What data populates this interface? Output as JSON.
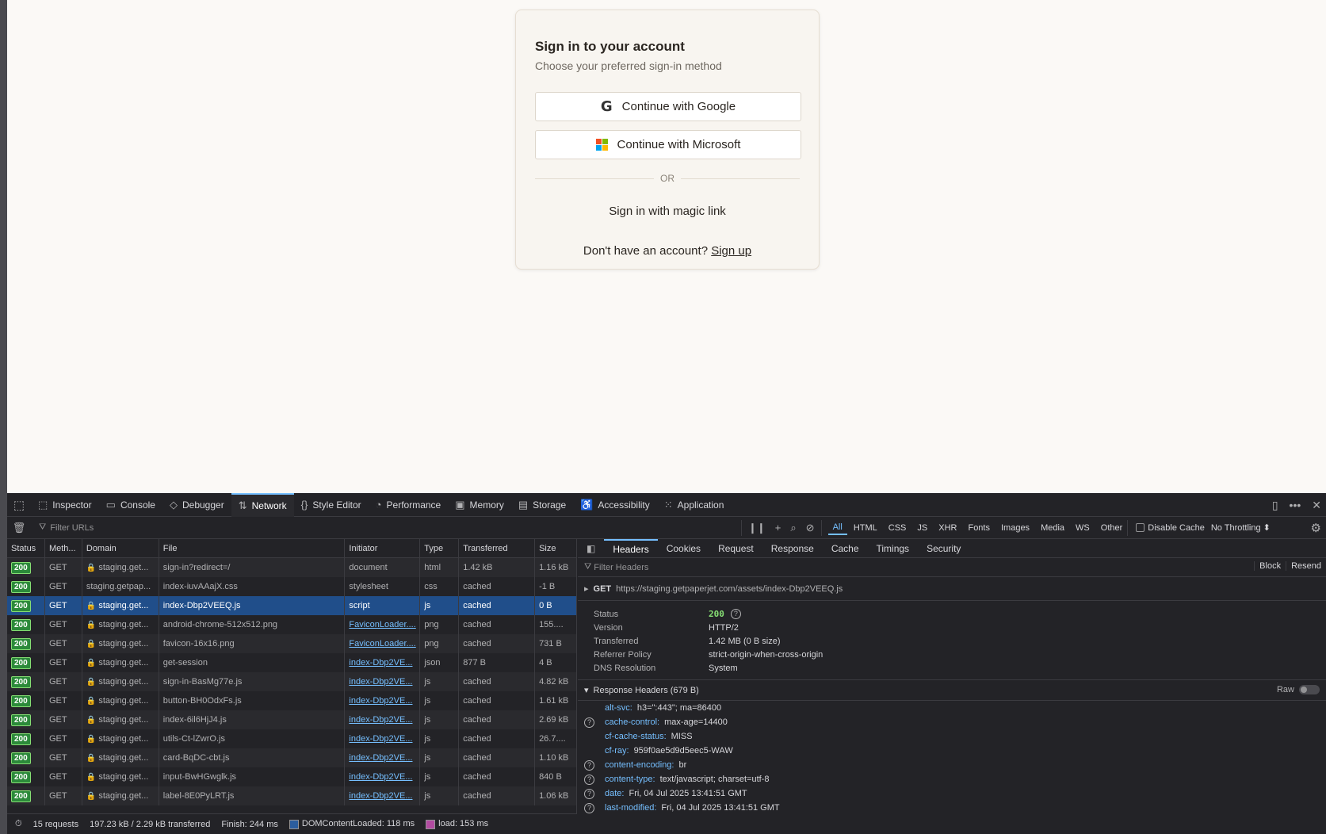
{
  "signin": {
    "title": "Sign in to your account",
    "subtitle": "Choose your preferred sign-in method",
    "google_label": "Continue with Google",
    "microsoft_label": "Continue with Microsoft",
    "or_text": "OR",
    "magic_link": "Sign in with magic link",
    "no_account": "Don't have an account?",
    "signup": "Sign up"
  },
  "devtools": {
    "tabs": [
      {
        "label": "Inspector",
        "icon": "inspector-icon"
      },
      {
        "label": "Console",
        "icon": "console-icon"
      },
      {
        "label": "Debugger",
        "icon": "debugger-icon"
      },
      {
        "label": "Network",
        "icon": "network-icon"
      },
      {
        "label": "Style Editor",
        "icon": "style-editor-icon"
      },
      {
        "label": "Performance",
        "icon": "performance-icon"
      },
      {
        "label": "Memory",
        "icon": "memory-icon"
      },
      {
        "label": "Storage",
        "icon": "storage-icon"
      },
      {
        "label": "Accessibility",
        "icon": "accessibility-icon"
      },
      {
        "label": "Application",
        "icon": "application-icon"
      }
    ],
    "active_tab": "Network",
    "filter_placeholder": "Filter URLs",
    "type_filters": [
      "All",
      "HTML",
      "CSS",
      "JS",
      "XHR",
      "Fonts",
      "Images",
      "Media",
      "WS",
      "Other"
    ],
    "disable_cache": "Disable Cache",
    "throttling": "No Throttling",
    "columns": [
      "Status",
      "Meth...",
      "Domain",
      "File",
      "Initiator",
      "Type",
      "Transferred",
      "Size"
    ],
    "rows": [
      {
        "status": "200",
        "method": "GET",
        "domain": "staging.get...",
        "file": "sign-in?redirect=/",
        "initiator": "document",
        "type": "html",
        "transferred": "1.42 kB",
        "size": "1.16 kB"
      },
      {
        "status": "200",
        "method": "GET",
        "domain": "staging.getpap...",
        "file": "index-iuvAAajX.css",
        "initiator": "stylesheet",
        "type": "css",
        "transferred": "cached",
        "size": "-1 B"
      },
      {
        "status": "200",
        "method": "GET",
        "domain": "staging.get...",
        "file": "index-Dbp2VEEQ.js",
        "initiator": "script",
        "type": "js",
        "transferred": "cached",
        "size": "0 B"
      },
      {
        "status": "200",
        "method": "GET",
        "domain": "staging.get...",
        "file": "android-chrome-512x512.png",
        "initiator": "FaviconLoader....",
        "type": "png",
        "transferred": "cached",
        "size": "155...."
      },
      {
        "status": "200",
        "method": "GET",
        "domain": "staging.get...",
        "file": "favicon-16x16.png",
        "initiator": "FaviconLoader....",
        "type": "png",
        "transferred": "cached",
        "size": "731 B"
      },
      {
        "status": "200",
        "method": "GET",
        "domain": "staging.get...",
        "file": "get-session",
        "initiator": "index-Dbp2VE...",
        "type": "json",
        "transferred": "877 B",
        "size": "4 B"
      },
      {
        "status": "200",
        "method": "GET",
        "domain": "staging.get...",
        "file": "sign-in-BasMg77e.js",
        "initiator": "index-Dbp2VE...",
        "type": "js",
        "transferred": "cached",
        "size": "4.82 kB"
      },
      {
        "status": "200",
        "method": "GET",
        "domain": "staging.get...",
        "file": "button-BH0OdxFs.js",
        "initiator": "index-Dbp2VE...",
        "type": "js",
        "transferred": "cached",
        "size": "1.61 kB"
      },
      {
        "status": "200",
        "method": "GET",
        "domain": "staging.get...",
        "file": "index-6il6HjJ4.js",
        "initiator": "index-Dbp2VE...",
        "type": "js",
        "transferred": "cached",
        "size": "2.69 kB"
      },
      {
        "status": "200",
        "method": "GET",
        "domain": "staging.get...",
        "file": "utils-Ct-lZwrO.js",
        "initiator": "index-Dbp2VE...",
        "type": "js",
        "transferred": "cached",
        "size": "26.7...."
      },
      {
        "status": "200",
        "method": "GET",
        "domain": "staging.get...",
        "file": "card-BqDC-cbt.js",
        "initiator": "index-Dbp2VE...",
        "type": "js",
        "transferred": "cached",
        "size": "1.10 kB"
      },
      {
        "status": "200",
        "method": "GET",
        "domain": "staging.get...",
        "file": "input-BwHGwglk.js",
        "initiator": "index-Dbp2VE...",
        "type": "js",
        "transferred": "cached",
        "size": "840 B"
      },
      {
        "status": "200",
        "method": "GET",
        "domain": "staging.get...",
        "file": "label-8E0PyLRT.js",
        "initiator": "index-Dbp2VE...",
        "type": "js",
        "transferred": "cached",
        "size": "1.06 kB"
      }
    ],
    "status_bar": {
      "requests": "15 requests",
      "transferred": "197.23 kB / 2.29 kB transferred",
      "finish": "Finish: 244 ms",
      "dom": "DOMContentLoaded: 118 ms",
      "load": "load: 153 ms"
    },
    "details": {
      "tabs": [
        "Headers",
        "Cookies",
        "Request",
        "Response",
        "Cache",
        "Timings",
        "Security"
      ],
      "filter_placeholder": "Filter Headers",
      "block": "Block",
      "resend": "Resend",
      "method": "GET",
      "url": "https://staging.getpaperjet.com/assets/index-Dbp2VEEQ.js",
      "summary": [
        {
          "k": "Status",
          "v": "200"
        },
        {
          "k": "Version",
          "v": "HTTP/2"
        },
        {
          "k": "Transferred",
          "v": "1.42 MB (0 B size)"
        },
        {
          "k": "Referrer Policy",
          "v": "strict-origin-when-cross-origin"
        },
        {
          "k": "DNS Resolution",
          "v": "System"
        }
      ],
      "response_headers_title": "Response Headers (679 B)",
      "raw": "Raw",
      "headers": [
        {
          "k": "alt-svc:",
          "v": "h3=\":443\"; ma=86400",
          "help": false
        },
        {
          "k": "cache-control:",
          "v": "max-age=14400",
          "help": true
        },
        {
          "k": "cf-cache-status:",
          "v": "MISS",
          "help": false
        },
        {
          "k": "cf-ray:",
          "v": "959f0ae5d9d5eec5-WAW",
          "help": false
        },
        {
          "k": "content-encoding:",
          "v": "br",
          "help": true
        },
        {
          "k": "content-type:",
          "v": "text/javascript; charset=utf-8",
          "help": true
        },
        {
          "k": "date:",
          "v": "Fri, 04 Jul 2025 13:41:51 GMT",
          "help": true
        },
        {
          "k": "last-modified:",
          "v": "Fri, 04 Jul 2025 13:41:51 GMT",
          "help": true
        }
      ]
    }
  }
}
